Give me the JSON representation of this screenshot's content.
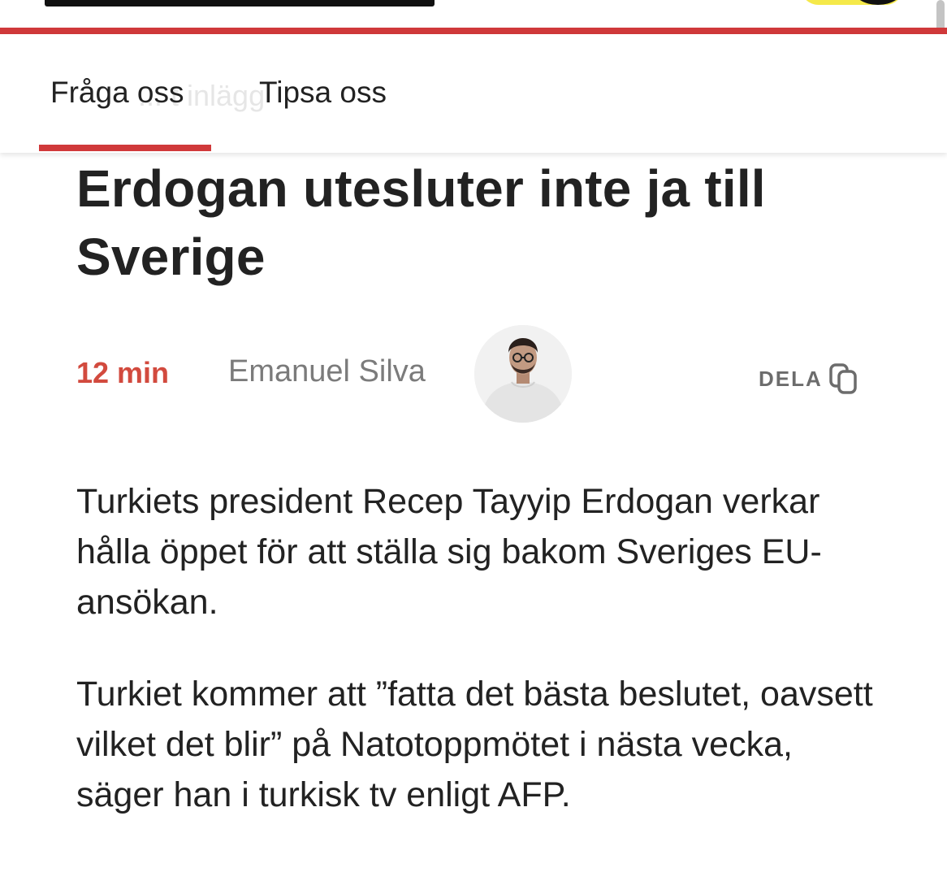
{
  "header": {
    "tabs": [
      {
        "label": "Fråga oss",
        "active": true
      },
      {
        "label": "Tipsa oss",
        "active": false
      }
    ],
    "ghost_text": "... t inlägg",
    "accent_color": "#d0393a"
  },
  "article": {
    "headline": "Erdogan utesluter inte ja till Sverige",
    "byline": {
      "read_time": "12 min",
      "author": "Emanuel Silva",
      "share_label": "DELA",
      "share_icon": "copy-icon"
    },
    "paragraphs": [
      "Turkiets president Recep Tayyip Erdogan verkar hålla öppet för att ställa sig bakom Sveriges EU-ansökan.",
      "Turkiet kommer att ”fatta det bästa beslutet, oavsett vilket det blir” på Natotoppmötet i nästa vecka, säger han i turkisk tv enligt AFP."
    ]
  }
}
